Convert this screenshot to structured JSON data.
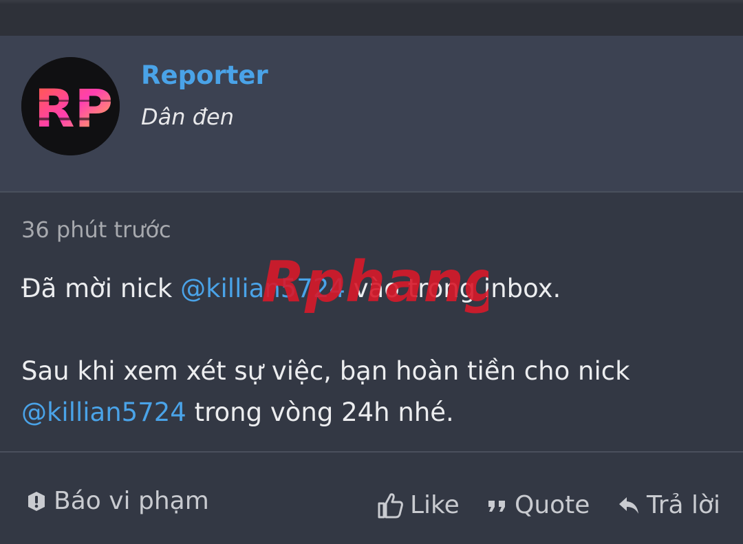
{
  "post": {
    "author": {
      "name": "Reporter",
      "title": "Dân đen",
      "avatar_text": "RP"
    },
    "timestamp": "36 phút trước",
    "message": {
      "line1_prefix": "Đã mời nick ",
      "line1_mention": "@killian5724",
      "line1_suffix": " vào trong inbox.",
      "line2": "Sau khi xem xét sự việc, bạn hoàn tiền cho nick",
      "line3_mention": "@killian5724",
      "line3_suffix": " trong vòng 24h nhé."
    },
    "actions": {
      "report_label": "Báo vi phạm",
      "like_label": "Like",
      "quote_label": "Quote",
      "reply_label": "Trả lời"
    }
  },
  "watermark": {
    "text": "Rphang"
  },
  "icons": {
    "report": "exclamation-circle-icon",
    "like": "thumbs-up-icon",
    "quote": "quote-icon",
    "reply": "reply-arrow-icon"
  },
  "colors": {
    "link": "#4aa3e8",
    "background": "#333844",
    "header_background": "#3c4252",
    "text": "#ecedef",
    "muted": "#a7a9ae"
  }
}
